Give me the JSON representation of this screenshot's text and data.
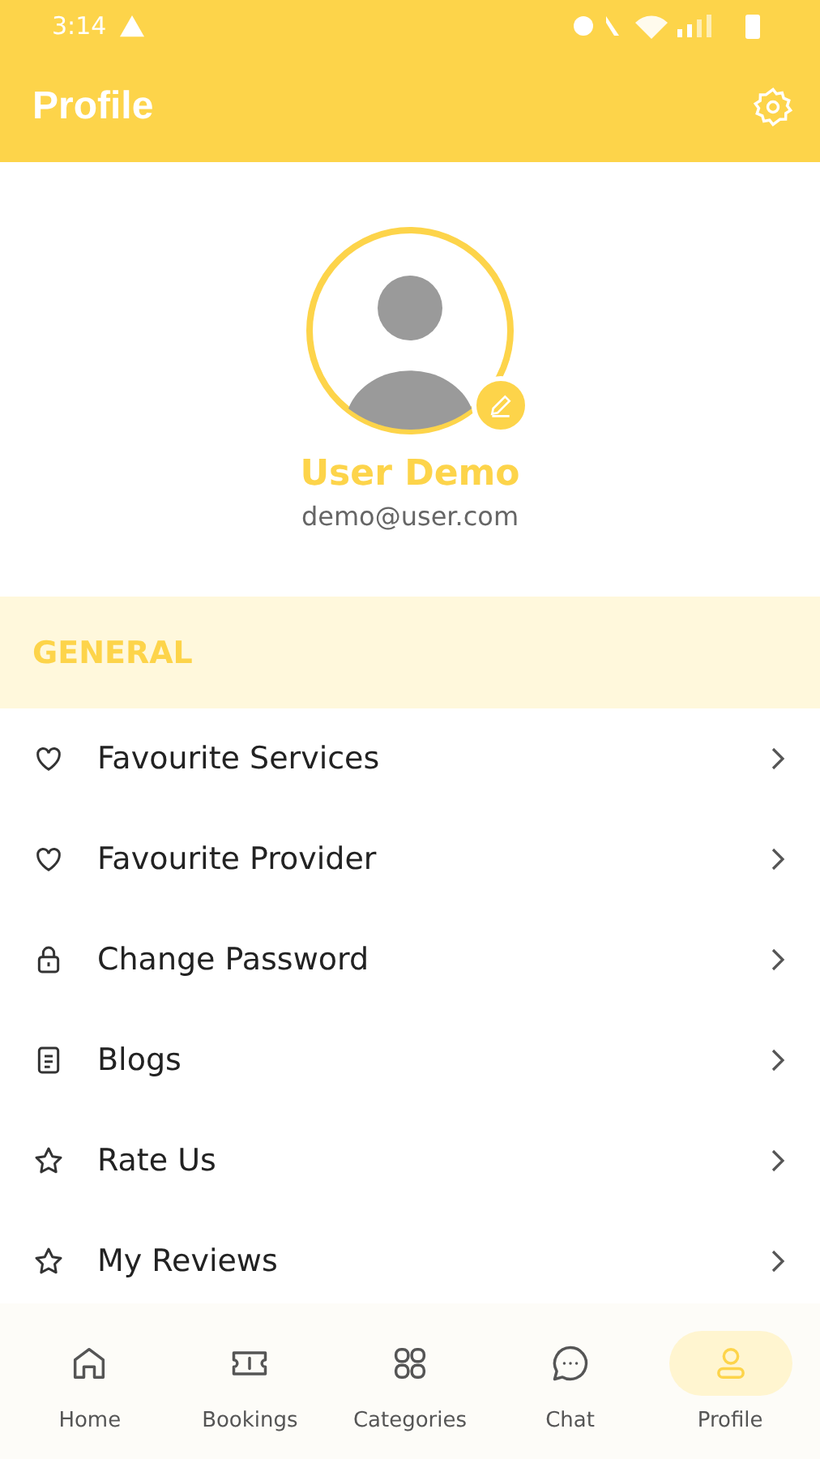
{
  "status_bar": {
    "time": "3:14"
  },
  "header": {
    "title": "Profile"
  },
  "profile": {
    "name": "User Demo",
    "email": "demo@user.com"
  },
  "section": {
    "title": "GENERAL"
  },
  "menu_items": [
    {
      "label": "Favourite Services",
      "kind": "heart"
    },
    {
      "label": "Favourite Provider",
      "kind": "heart"
    },
    {
      "label": "Change Password",
      "kind": "lock"
    },
    {
      "label": "Blogs",
      "kind": "document"
    },
    {
      "label": "Rate Us",
      "kind": "star"
    },
    {
      "label": "My Reviews",
      "kind": "star"
    }
  ],
  "bottom_nav": [
    {
      "label": "Home",
      "kind": "home",
      "selected": false
    },
    {
      "label": "Bookings",
      "kind": "ticket",
      "selected": false
    },
    {
      "label": "Categories",
      "kind": "grid",
      "selected": false
    },
    {
      "label": "Chat",
      "kind": "chat",
      "selected": false
    },
    {
      "label": "Profile",
      "kind": "user",
      "selected": true
    }
  ]
}
